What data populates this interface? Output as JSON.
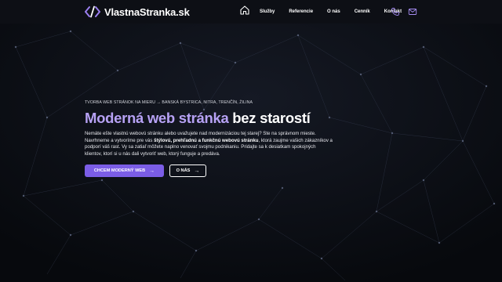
{
  "nav": {
    "logo_text": "VlastnaStranka.sk",
    "items": [
      "Služby",
      "Referencie",
      "O nás",
      "Cenník",
      "Kontakt"
    ],
    "icons": [
      "home-icon",
      "phone-icon",
      "mail-icon"
    ]
  },
  "hero": {
    "eyebrow": "TVORBA WEB STRÁNOK NA MIERU → BANSKÁ BYSTRICA, NITRA, TRENČÍN, ŽILINA",
    "headline_accent": "Moderná web stránka",
    "headline_rest": " bez starostí",
    "desc_part1": "Nemáte ešte vlastnú webovú stránku alebo uvažujete nad modernizáciou tej starej? Ste na správnom mieste. Navrhneme a vytvoríme pre vás ",
    "desc_bold": "štýlovú, prehľadnú a funkčnú webovú stránku",
    "desc_part2": ", ktorá zaujme vašich zákazníkov a podporí váš rast. Vy sa zatiaľ môžete naplno venovať svojmu podnikaniu. Pridajte sa k desiatkam spokojných klientov, ktorí si u nás dali vytvoriť web, ktorý funguje a predáva.",
    "primary_button": "CHCEM MODERNÝ WEB",
    "secondary_button": "O NÁS",
    "arrow": "→"
  },
  "colors": {
    "accent": "#7b5de6",
    "headline_accent": "#b7a2f5",
    "background": "#0c0e14"
  }
}
